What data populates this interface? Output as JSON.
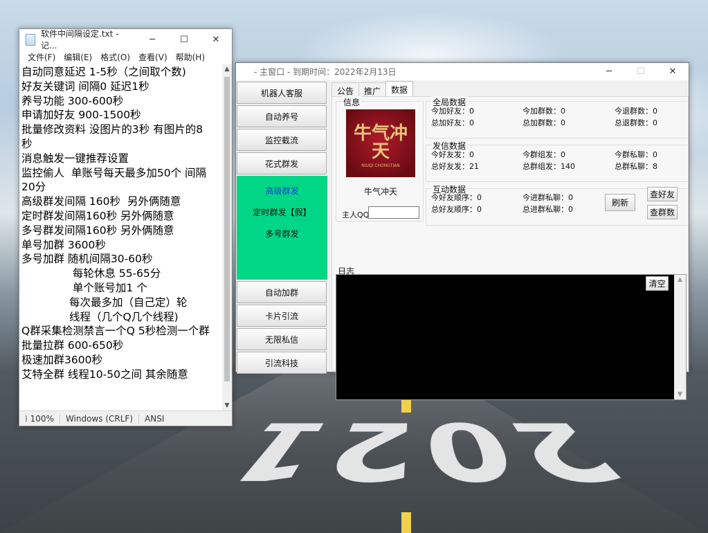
{
  "notepad": {
    "title": "软件中间隔设定.txt - 记...",
    "menu": [
      "文件(F)",
      "编辑(E)",
      "格式(O)",
      "查看(V)",
      "帮助(H)"
    ],
    "lines": [
      "自动同意延迟 1-5秒（之间取个数)",
      "好友关键词 间隔0 延迟1秒",
      "养号功能 300-600秒",
      "申请加好友 900-1500秒",
      "批量修改资料 没图片的3秒 有图片的8",
      "秒",
      "消息触发一键推荐设置",
      "监控偷人  单账号每天最多加50个 间隔",
      "20分",
      "高级群发间隔 160秒  另外俩随意",
      "定时群发间隔160秒 另外俩随意",
      "多号群发间隔160秒 另外俩随意",
      "单号加群 3600秒",
      "多号加群 随机间隔30-60秒",
      "               每轮休息 55-65分",
      "               单个账号加1 个",
      "              每次最多加（自己定）轮",
      "              线程（几个Q几个线程)",
      "Q群采集检测禁言一个Q 5秒检测一个群",
      "批量拉群 600-650秒",
      "极速加群3600秒",
      "艾特全群 线程10-50之间 其余随意"
    ],
    "status": {
      "zoom": "100%",
      "eol": "Windows (CRLF)",
      "encoding": "ANSI"
    }
  },
  "app": {
    "title": "- 主窗口 -  到期时间：2022年2月13日",
    "side_top": [
      "机器人客服",
      "自动养号",
      "监控截流",
      "花式群发"
    ],
    "green_items": [
      "高级群发",
      "定时群发【假】",
      "多号群发"
    ],
    "side_bottom": [
      "自动加群",
      "卡片引流",
      "无限私信",
      "引流科技"
    ],
    "tabs": [
      "公告",
      "推广",
      "数据"
    ],
    "info": {
      "group": "信息",
      "logo_text": "牛气冲天",
      "logo_sub": "NIUQI CHONGTIAN",
      "name": "牛气冲天",
      "qq_label": "主人QQ",
      "qq_value": ""
    },
    "global": {
      "title": "全局数据",
      "items": [
        [
          "今加好友：0",
          "今加群数：0",
          "今退群数：0"
        ],
        [
          "总加好友：0",
          "总加群数：0",
          "总退群数：0"
        ]
      ]
    },
    "send": {
      "title": "发信数据",
      "items": [
        [
          "今好友发：0",
          "今群组发：0",
          "今群私聊：0"
        ],
        [
          "总好友发：21",
          "总群组发：140",
          "总群私聊：8"
        ]
      ]
    },
    "interact": {
      "title": "互动数据",
      "items": [
        [
          "今好友顺序：0",
          "今进群私聊：0"
        ],
        [
          "总好友顺序：0",
          "总进群私聊：0"
        ]
      ],
      "refresh": "刷新",
      "check_friends": "查好友",
      "check_groups": "查群数"
    },
    "log": {
      "title": "日志",
      "clear": "清空"
    }
  },
  "wallpaper": {
    "year": "2021"
  }
}
